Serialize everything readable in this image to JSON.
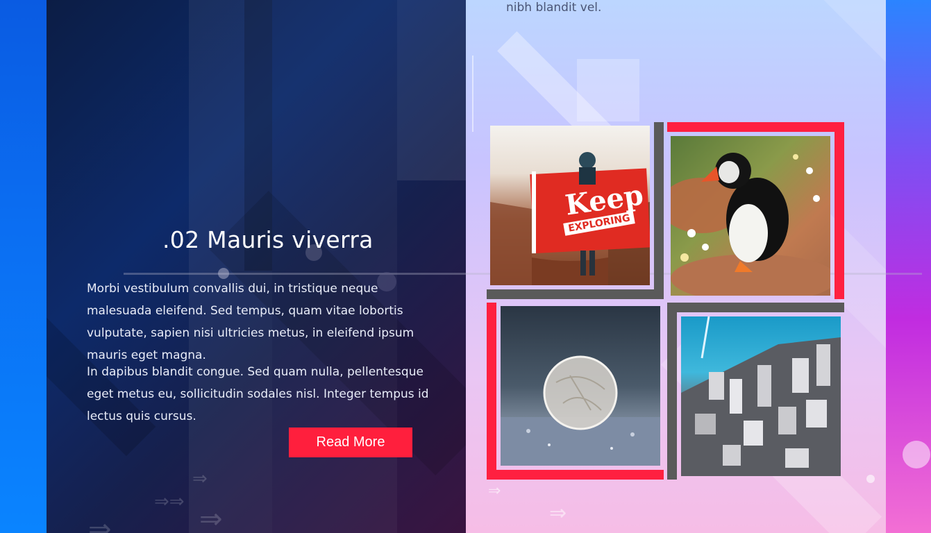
{
  "top_fragment": "nibh blandit vel.",
  "section": {
    "title": ".02 Mauris viverra",
    "paragraphs": [
      "Morbi vestibulum convallis dui, in tristique neque malesuada eleifend. Sed tempus, quam vitae lobortis vulputate, sapien nisi ultricies metus, in eleifend ipsum mauris eget magna.",
      "In dapibus blandit congue. Sed quam nulla, pellentesque eget metus eu, sollicitudin sodales nisl. Integer tempus id lectus quis cursus."
    ],
    "button_label": "Read More"
  },
  "gallery": {
    "flag_text_top": "Keep",
    "flag_text_bottom": "EXPLORING"
  },
  "colors": {
    "accent": "#ff1f3d",
    "frame_gray": "#5a5a5a"
  }
}
